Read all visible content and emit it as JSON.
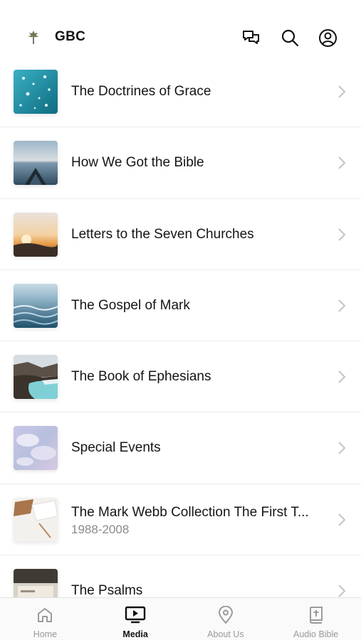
{
  "header": {
    "brand": "GBC",
    "icons": {
      "chat": "chat-bubbles-icon",
      "search": "search-icon",
      "account": "account-icon"
    }
  },
  "items": [
    {
      "title": "The Doctrines of Grace",
      "subtitle": ""
    },
    {
      "title": "How We Got the Bible",
      "subtitle": ""
    },
    {
      "title": "Letters to the Seven Churches",
      "subtitle": ""
    },
    {
      "title": "The Gospel of Mark",
      "subtitle": ""
    },
    {
      "title": "The Book of Ephesians",
      "subtitle": ""
    },
    {
      "title": "Special Events",
      "subtitle": ""
    },
    {
      "title": "The Mark Webb Collection The First T...",
      "subtitle": "1988-2008"
    },
    {
      "title": "The Psalms",
      "subtitle": ""
    }
  ],
  "tabs": [
    {
      "label": "Home",
      "active": false
    },
    {
      "label": "Media",
      "active": true
    },
    {
      "label": "About Us",
      "active": false
    },
    {
      "label": "Audio Bible",
      "active": false
    }
  ],
  "colors": {
    "active": "#111111",
    "inactive": "#9a9a9a",
    "chevron": "#c4c4c4"
  }
}
